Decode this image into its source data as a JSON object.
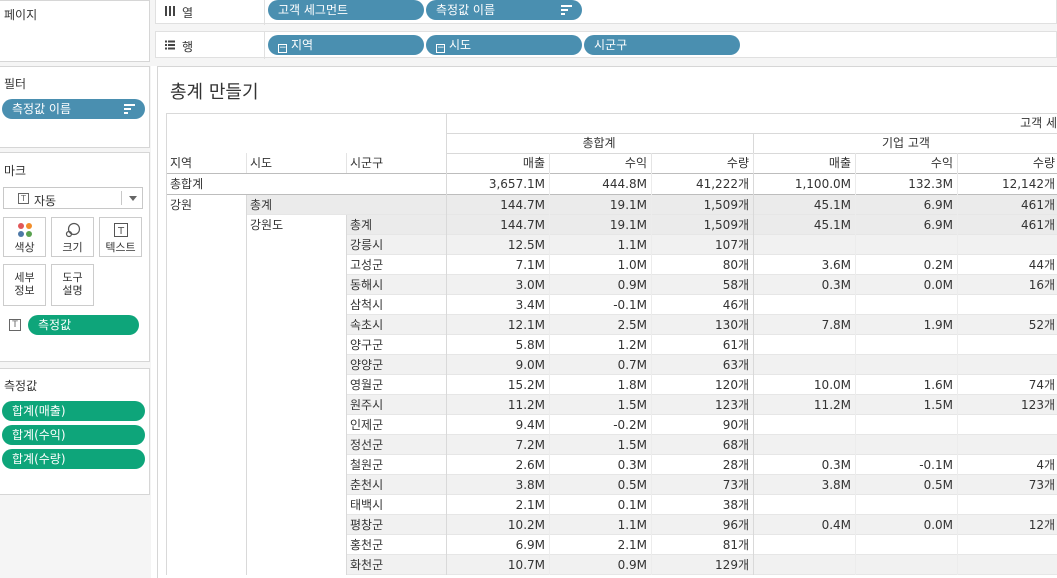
{
  "left": {
    "pages_title": "페이지",
    "filters_title": "필터",
    "filter_pills": [
      {
        "label": "측정값 이름",
        "color": "#4a8fb0"
      }
    ],
    "marks_title": "마크",
    "mark_type": "자동",
    "mark_buttons": {
      "color": "색상",
      "size": "크기",
      "text": "텍스트",
      "detail": "세부\n정보",
      "tooltip": "도구\n설명"
    },
    "marks_pill": "측정값",
    "measure_values_title": "측정값",
    "measure_pills": [
      "합계(매출)",
      "합계(수익)",
      "합계(수량)"
    ],
    "accent_green": "#0ea57a",
    "accent_blue": "#4a8fb0"
  },
  "shelves": {
    "columns_label": "열",
    "columns_icon": "columns-icon",
    "column_pills": [
      "고객 세그먼트",
      "측정값 이름"
    ],
    "rows_label": "행",
    "rows_icon": "rows-icon",
    "row_pills": [
      "지역",
      "시도",
      "시군구"
    ]
  },
  "view": {
    "title": "총계 만들기",
    "header": {
      "top_segment": "고객 세",
      "segments": [
        "총합계",
        "기업 고객"
      ],
      "row_headers": [
        "지역",
        "시도",
        "시군구"
      ],
      "measures": [
        "매출",
        "수익",
        "수량",
        "매출",
        "수익",
        "수량"
      ]
    },
    "grand_total": {
      "label": "총합계",
      "values": [
        "3,657.1M",
        "444.8M",
        "41,222개",
        "1,100.0M",
        "132.3M",
        "12,142개"
      ]
    },
    "rows": [
      {
        "region": "강원",
        "sido": "총계",
        "sigungu": "",
        "values": [
          "144.7M",
          "19.1M",
          "1,509개",
          "45.1M",
          "6.9M",
          "461개"
        ],
        "highlight": true
      },
      {
        "region": "",
        "sido": "강원도",
        "sigungu": "총계",
        "values": [
          "144.7M",
          "19.1M",
          "1,509개",
          "45.1M",
          "6.9M",
          "461개"
        ],
        "highlight": true
      },
      {
        "region": "",
        "sido": "",
        "sigungu": "강릉시",
        "values": [
          "12.5M",
          "1.1M",
          "107개",
          "",
          "",
          ""
        ]
      },
      {
        "region": "",
        "sido": "",
        "sigungu": "고성군",
        "values": [
          "7.1M",
          "1.0M",
          "80개",
          "3.6M",
          "0.2M",
          "44개"
        ]
      },
      {
        "region": "",
        "sido": "",
        "sigungu": "동해시",
        "values": [
          "3.0M",
          "0.9M",
          "58개",
          "0.3M",
          "0.0M",
          "16개"
        ]
      },
      {
        "region": "",
        "sido": "",
        "sigungu": "삼척시",
        "values": [
          "3.4M",
          "-0.1M",
          "46개",
          "",
          "",
          ""
        ]
      },
      {
        "region": "",
        "sido": "",
        "sigungu": "속초시",
        "values": [
          "12.1M",
          "2.5M",
          "130개",
          "7.8M",
          "1.9M",
          "52개"
        ]
      },
      {
        "region": "",
        "sido": "",
        "sigungu": "양구군",
        "values": [
          "5.8M",
          "1.2M",
          "61개",
          "",
          "",
          ""
        ]
      },
      {
        "region": "",
        "sido": "",
        "sigungu": "양양군",
        "values": [
          "9.0M",
          "0.7M",
          "63개",
          "",
          "",
          ""
        ]
      },
      {
        "region": "",
        "sido": "",
        "sigungu": "영월군",
        "values": [
          "15.2M",
          "1.8M",
          "120개",
          "10.0M",
          "1.6M",
          "74개"
        ]
      },
      {
        "region": "",
        "sido": "",
        "sigungu": "원주시",
        "values": [
          "11.2M",
          "1.5M",
          "123개",
          "11.2M",
          "1.5M",
          "123개"
        ]
      },
      {
        "region": "",
        "sido": "",
        "sigungu": "인제군",
        "values": [
          "9.4M",
          "-0.2M",
          "90개",
          "",
          "",
          ""
        ]
      },
      {
        "region": "",
        "sido": "",
        "sigungu": "정선군",
        "values": [
          "7.2M",
          "1.5M",
          "68개",
          "",
          "",
          ""
        ]
      },
      {
        "region": "",
        "sido": "",
        "sigungu": "철원군",
        "values": [
          "2.6M",
          "0.3M",
          "28개",
          "0.3M",
          "-0.1M",
          "4개"
        ]
      },
      {
        "region": "",
        "sido": "",
        "sigungu": "춘천시",
        "values": [
          "3.8M",
          "0.5M",
          "73개",
          "3.8M",
          "0.5M",
          "73개"
        ]
      },
      {
        "region": "",
        "sido": "",
        "sigungu": "태백시",
        "values": [
          "2.1M",
          "0.1M",
          "38개",
          "",
          "",
          ""
        ]
      },
      {
        "region": "",
        "sido": "",
        "sigungu": "평창군",
        "values": [
          "10.2M",
          "1.1M",
          "96개",
          "0.4M",
          "0.0M",
          "12개"
        ]
      },
      {
        "region": "",
        "sido": "",
        "sigungu": "홍천군",
        "values": [
          "6.9M",
          "2.1M",
          "81개",
          "",
          "",
          ""
        ]
      },
      {
        "region": "",
        "sido": "",
        "sigungu": "화천군",
        "values": [
          "10.7M",
          "0.9M",
          "129개",
          "",
          "",
          ""
        ]
      }
    ]
  }
}
